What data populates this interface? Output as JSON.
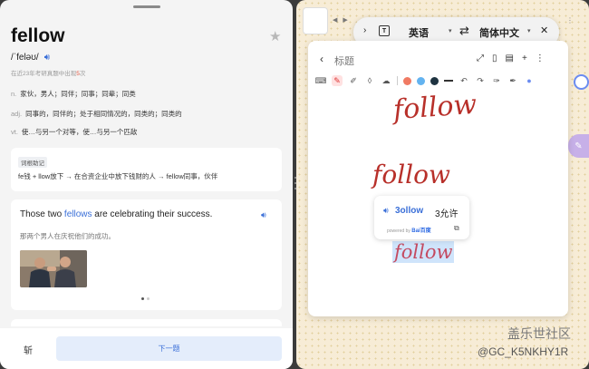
{
  "left": {
    "word": "fellow",
    "phonetic": "/ˈfeləʊ/",
    "frequency_prefix": "在近23年考研真题中出现",
    "frequency_count": "5",
    "frequency_suffix": "次",
    "definitions": [
      {
        "pos": "n.",
        "text": "家伙，男人；同伴；同事；同辈；同类"
      },
      {
        "pos": "adj.",
        "text": "同事的，同伴的；处于相同情况的，同类的；同类的"
      },
      {
        "pos": "vt.",
        "text": "使…与另一个对等，使…与另一个匹敌"
      }
    ],
    "memory": {
      "tag": "词根助记",
      "text": "fe钱 + llow放下 → 在合资企业中放下钱财的人 → fellow同事，伙伴"
    },
    "example": {
      "before": "Those two ",
      "highlight": "fellows",
      "after": " are celebrating their success.",
      "translation": "那两个男人在庆祝他们的成功。"
    },
    "chop_label": "斩",
    "next_label": "下一题"
  },
  "right": {
    "translate_bar": {
      "source_lang": "英语",
      "target_lang": "简体中文"
    },
    "note": {
      "title": "标题",
      "handwriting": [
        "follow",
        "follow",
        "follow"
      ]
    },
    "popup": {
      "source": "3ollow",
      "result": "3允许",
      "powered_by": "powered by",
      "brand": "Bai百度"
    },
    "watermark_1": "盖乐世社区",
    "watermark_2": "@GC_K5NKHY1R"
  },
  "colors": {
    "accent_blue": "#3a6fd8",
    "ink_red": "#b8302a",
    "paper": "#f7ecd6"
  }
}
